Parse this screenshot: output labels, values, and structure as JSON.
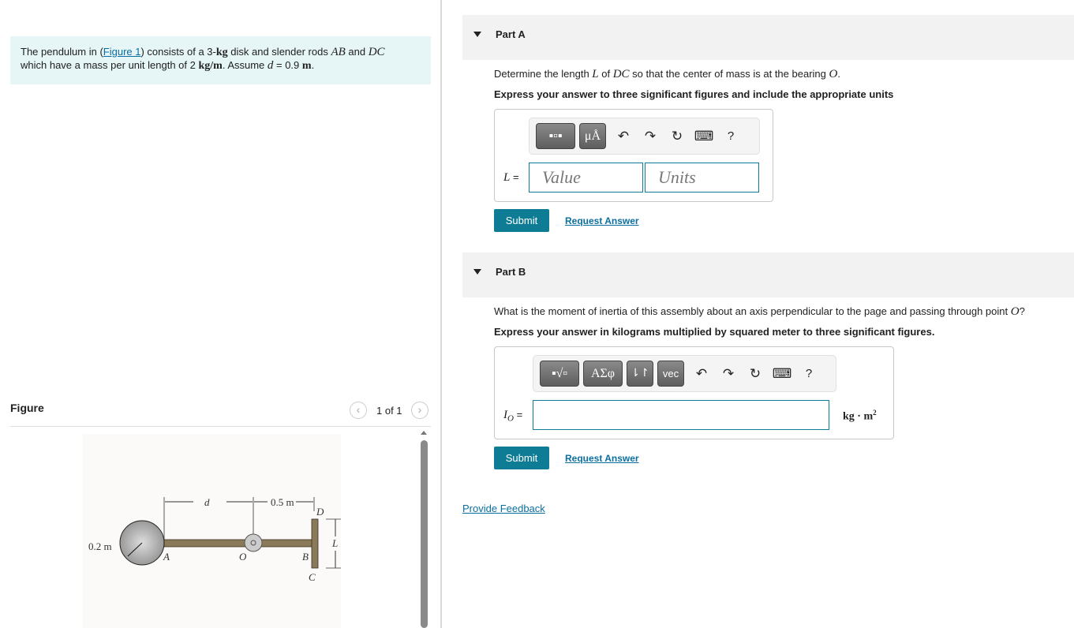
{
  "intro": {
    "p1": "The pendulum in (",
    "link": "Figure 1",
    "p2": ") consists of a 3-",
    "kg": "kg",
    "p3": " disk and slender rods ",
    "AB": "AB",
    "and": " and ",
    "DC": "DC",
    "p4": "which have a mass per unit length of 2 ",
    "kgm": "kg/m",
    "p5": ". Assume ",
    "d": "d",
    "p6": " = 0.9 ",
    "m": "m",
    "p7": "."
  },
  "figure": {
    "title": "Figure",
    "pager": "1 of 1",
    "labels": {
      "d": "d",
      "half": "0.5 m",
      "D": "D",
      "L": "L",
      "r": "0.2 m",
      "A": "A",
      "O": "O",
      "B": "B",
      "C": "C"
    }
  },
  "partA": {
    "label": "Part A",
    "q1": "Determine the length ",
    "L": "L",
    "q2": " of ",
    "DC": "DC",
    "q3": " so that the center of mass is at the bearing ",
    "O": "O",
    "q4": ".",
    "instr": "Express your answer to three significant figures and include the appropriate units",
    "var": "L",
    "eq": " =",
    "value_placeholder": "Value",
    "units_placeholder": "Units",
    "units_btn": "μÅ",
    "help": "?",
    "submit": "Submit",
    "request": "Request Answer"
  },
  "partB": {
    "label": "Part B",
    "q1": "What is the moment of inertia of this assembly about an axis perpendicular to the page and passing through point ",
    "O": "O",
    "q2": "?",
    "instr": "Express your answer in kilograms multiplied by squared meter to three significant figures.",
    "var": "I",
    "sub": "O",
    "eq": " =",
    "unit": "kg · m",
    "sup": "2",
    "greek": "ΑΣφ",
    "arrows": "⇂↾",
    "vec": "vec",
    "help": "?",
    "submit": "Submit",
    "request": "Request Answer"
  },
  "feedback": "Provide Feedback",
  "colors": {
    "accent": "#0e7c95",
    "link": "#0a6fa0",
    "intro_bg": "#e6f5f5"
  }
}
